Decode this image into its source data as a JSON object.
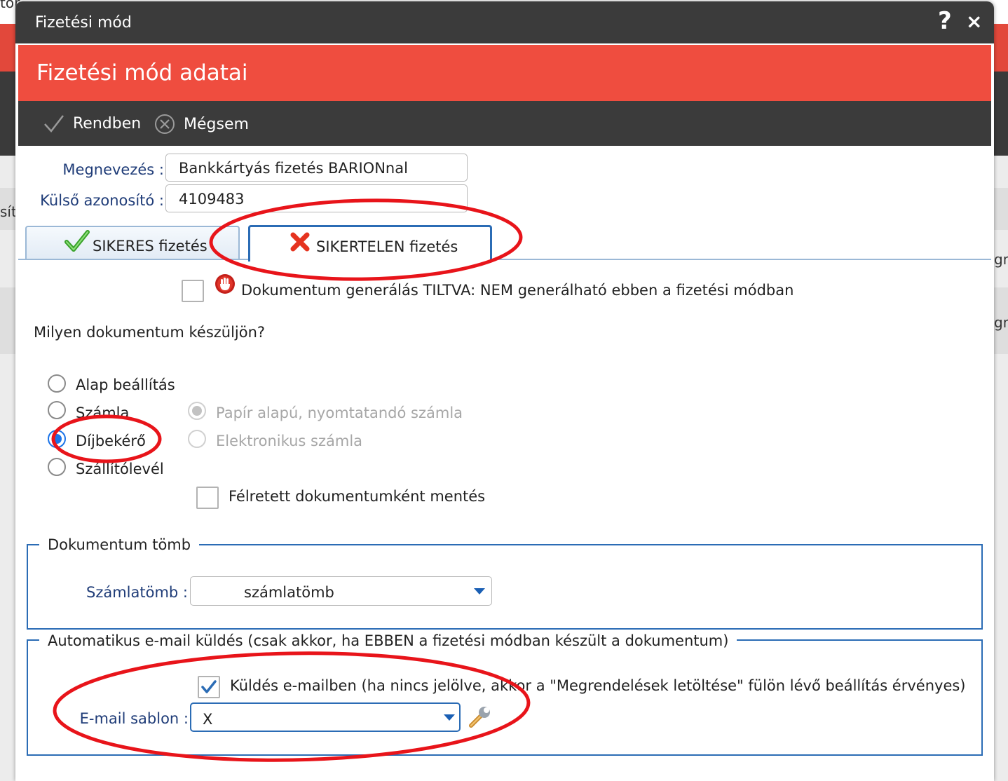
{
  "background": {
    "frag_top": "tör",
    "frag_left": "sít",
    "frag_right1": "gny",
    "frag_right2": "gny"
  },
  "window": {
    "title": "Fizetési mód",
    "help_label": "?",
    "close_label": "×"
  },
  "header": {
    "title": "Fizetési mód adatai"
  },
  "toolbar": {
    "ok_label": "Rendben",
    "cancel_label": "Mégsem"
  },
  "form": {
    "name_label": "Megnevezés :",
    "name_value": "Bankkártyás fizetés BARIONnal",
    "extid_label": "Külső azonosító :",
    "extid_value": "4109483"
  },
  "tabs": [
    {
      "label": "SIKERES fizetés",
      "icon": "check-icon",
      "active": false
    },
    {
      "label": "SIKERTELEN fizetés",
      "icon": "x-icon",
      "active": true
    }
  ],
  "panel": {
    "forbid_label": "Dokumentum generálás TILTVA: NEM generálható ebben a fizetési módban",
    "forbid_checked": false,
    "question": "Milyen dokumentum készüljön?",
    "doc_types": [
      {
        "label": "Alap beállítás",
        "checked": false
      },
      {
        "label": "Számla",
        "checked": false
      },
      {
        "label": "Díjbekérő",
        "checked": true
      },
      {
        "label": "Szállítólevél",
        "checked": false
      }
    ],
    "invoice_types": [
      {
        "label": "Papír alapú, nyomtatandó számla",
        "checked": true,
        "disabled": true
      },
      {
        "label": "Elektronikus számla",
        "checked": false,
        "disabled": true
      }
    ],
    "draft_label": "Félretett dokumentumként mentés",
    "draft_checked": false,
    "block_section": {
      "legend": "Dokumentum tömb",
      "label": "Számlatömb :",
      "value": "számlatömb"
    },
    "email_section": {
      "legend": "Automatikus e-mail küldés (csak akkor, ha EBBEN a fizetési módban készült a dokumentum)",
      "send_label": "Küldés e-mailben (ha nincs jelölve, akkor a \"Megrendelések letöltése\" fülön lévő beállítás érvényes)",
      "send_checked": true,
      "template_label": "E-mail sablon :",
      "template_value": "X"
    }
  },
  "colors": {
    "accent_red": "#ef4d3f",
    "dark_bar": "#3b3b3b",
    "label_blue": "#1f3c78",
    "focus_blue": "#2b6cb5",
    "annotation_red": "#e8141a"
  }
}
